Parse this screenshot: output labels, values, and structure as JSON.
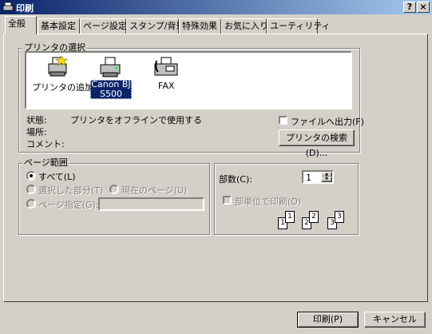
{
  "window": {
    "title": "印刷",
    "help_label": "?",
    "close_label": "×"
  },
  "tabs": [
    {
      "label": "全般"
    },
    {
      "label": "基本設定"
    },
    {
      "label": "ページ設定"
    },
    {
      "label": "スタンプ/背景"
    },
    {
      "label": "特殊効果"
    },
    {
      "label": "お気に入り"
    },
    {
      "label": "ユーティリティ"
    }
  ],
  "printer_select": {
    "legend": "プリンタの選択",
    "printers": [
      {
        "label": "プリンタの追加",
        "icon": "add-printer-icon"
      },
      {
        "label_line1": "Canon BJ",
        "label_line2": "S500",
        "icon": "printer-icon",
        "selected": true
      },
      {
        "label": "FAX",
        "icon": "fax-icon"
      }
    ],
    "status_label": "状態:",
    "status_value": "プリンタをオフラインで使用する",
    "location_label": "場所:",
    "comment_label": "コメント:",
    "print_to_file_label": "ファイルへ出力(F)",
    "print_to_file_checked": false,
    "find_printer_button": "プリンタの検索(D)..."
  },
  "page_range": {
    "legend": "ページ範囲",
    "all_label": "すべて(L)",
    "selection_label": "選択した部分(T)",
    "current_page_label": "現在のページ(U)",
    "pages_label": "ページ指定(G):",
    "pages_value": ""
  },
  "copies": {
    "label": "部数(C):",
    "value": "1",
    "collate_label": "部単位で印刷(O)",
    "collate_checked": false,
    "collate_pages": [
      "1",
      "1",
      "2",
      "2",
      "3",
      "3"
    ]
  },
  "buttons": {
    "print": "印刷(P)",
    "cancel": "キャンセル"
  },
  "colors": {
    "title_bar": "#0a246a",
    "face": "#d4d0c8",
    "selection": "#0a246a"
  }
}
